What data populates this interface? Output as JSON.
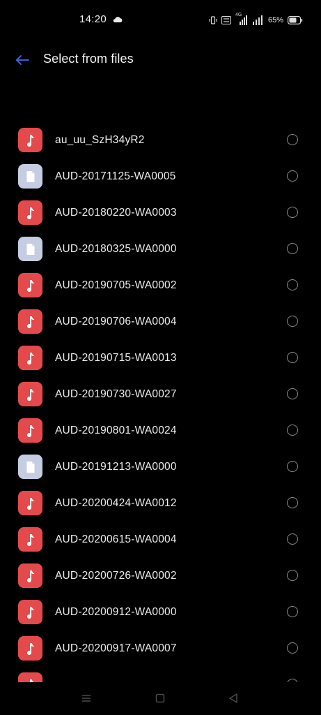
{
  "status_bar": {
    "time": "14:20",
    "battery_percent": "65%",
    "network_label_top": "4G",
    "icons": [
      "cloud-icon",
      "vibrate-icon",
      "volte-icon",
      "signal-icon",
      "signal-icon",
      "battery-icon"
    ]
  },
  "app_bar": {
    "title": "Select from files",
    "back_icon": "arrow-left-icon",
    "accent_color": "#3f6cf2"
  },
  "files": [
    {
      "name": "au_uu_SzH34yR2",
      "type": "audio",
      "icon": "music-note-icon"
    },
    {
      "name": "AUD-20171125-WA0005",
      "type": "document",
      "icon": "document-icon"
    },
    {
      "name": "AUD-20180220-WA0003",
      "type": "audio",
      "icon": "music-note-icon"
    },
    {
      "name": "AUD-20180325-WA0000",
      "type": "document",
      "icon": "document-icon"
    },
    {
      "name": "AUD-20190705-WA0002",
      "type": "audio",
      "icon": "music-note-icon"
    },
    {
      "name": "AUD-20190706-WA0004",
      "type": "audio",
      "icon": "music-note-icon"
    },
    {
      "name": "AUD-20190715-WA0013",
      "type": "audio",
      "icon": "music-note-icon"
    },
    {
      "name": "AUD-20190730-WA0027",
      "type": "audio",
      "icon": "music-note-icon"
    },
    {
      "name": "AUD-20190801-WA0024",
      "type": "audio",
      "icon": "music-note-icon"
    },
    {
      "name": "AUD-20191213-WA0000",
      "type": "document",
      "icon": "document-icon"
    },
    {
      "name": "AUD-20200424-WA0012",
      "type": "audio",
      "icon": "music-note-icon"
    },
    {
      "name": "AUD-20200615-WA0004",
      "type": "audio",
      "icon": "music-note-icon"
    },
    {
      "name": "AUD-20200726-WA0002",
      "type": "audio",
      "icon": "music-note-icon"
    },
    {
      "name": "AUD-20200912-WA0000",
      "type": "audio",
      "icon": "music-note-icon"
    },
    {
      "name": "AUD-20200917-WA0007",
      "type": "audio",
      "icon": "music-note-icon"
    },
    {
      "name": "",
      "type": "audio",
      "icon": "music-note-icon"
    }
  ],
  "colors": {
    "background": "#000000",
    "audio_icon_bg": "#e44a4c",
    "document_icon_bg": "#c5cde2"
  },
  "nav_bar": {
    "buttons": [
      "menu-icon",
      "home-icon",
      "back-triangle-icon"
    ]
  }
}
